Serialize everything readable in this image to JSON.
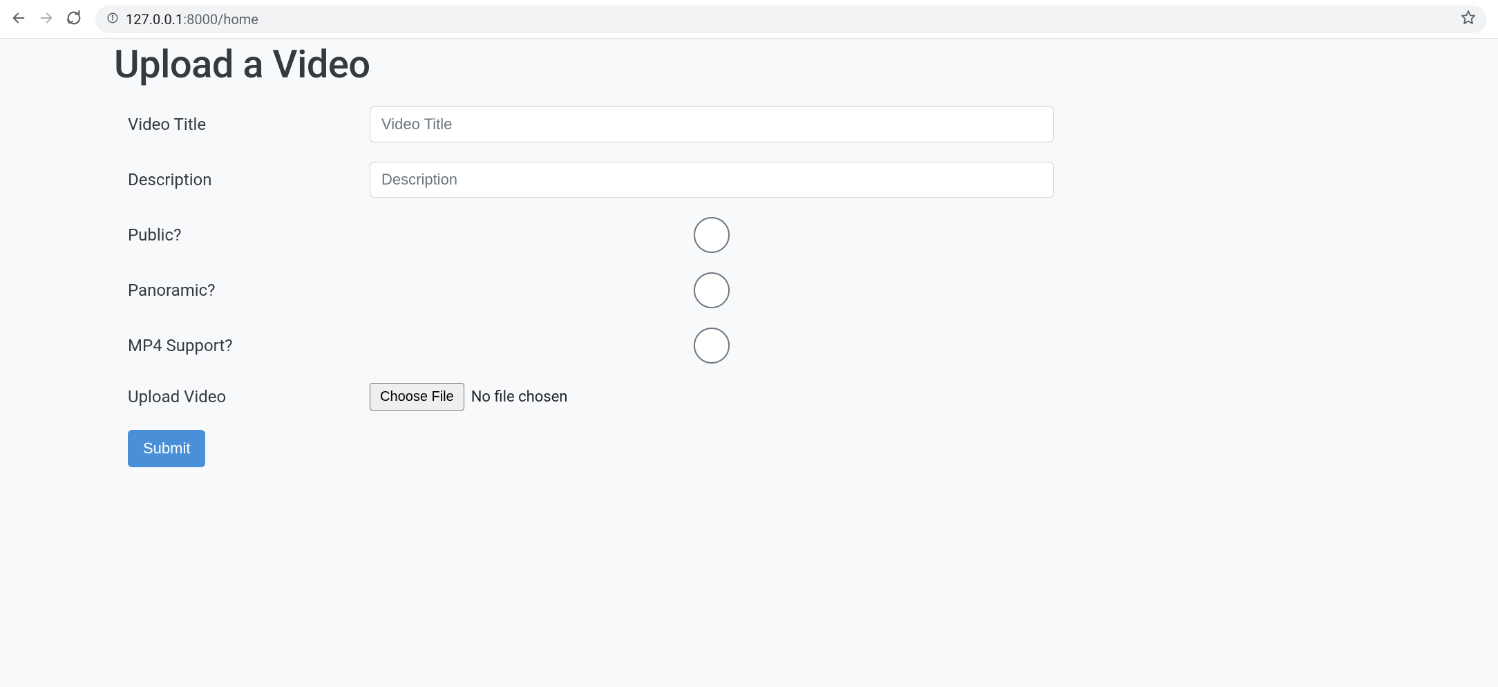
{
  "browser": {
    "url_host": "127.0.0.1",
    "url_port_path": ":8000/home"
  },
  "page": {
    "title": "Upload a Video"
  },
  "form": {
    "video_title": {
      "label": "Video Title",
      "placeholder": "Video Title",
      "value": ""
    },
    "description": {
      "label": "Description",
      "placeholder": "Description",
      "value": ""
    },
    "public": {
      "label": "Public?",
      "checked": false
    },
    "panoramic": {
      "label": "Panoramic?",
      "checked": false
    },
    "mp4_support": {
      "label": "MP4 Support?",
      "checked": false
    },
    "upload": {
      "label": "Upload Video",
      "button_label": "Choose File",
      "status": "No file chosen"
    },
    "submit_label": "Submit"
  }
}
